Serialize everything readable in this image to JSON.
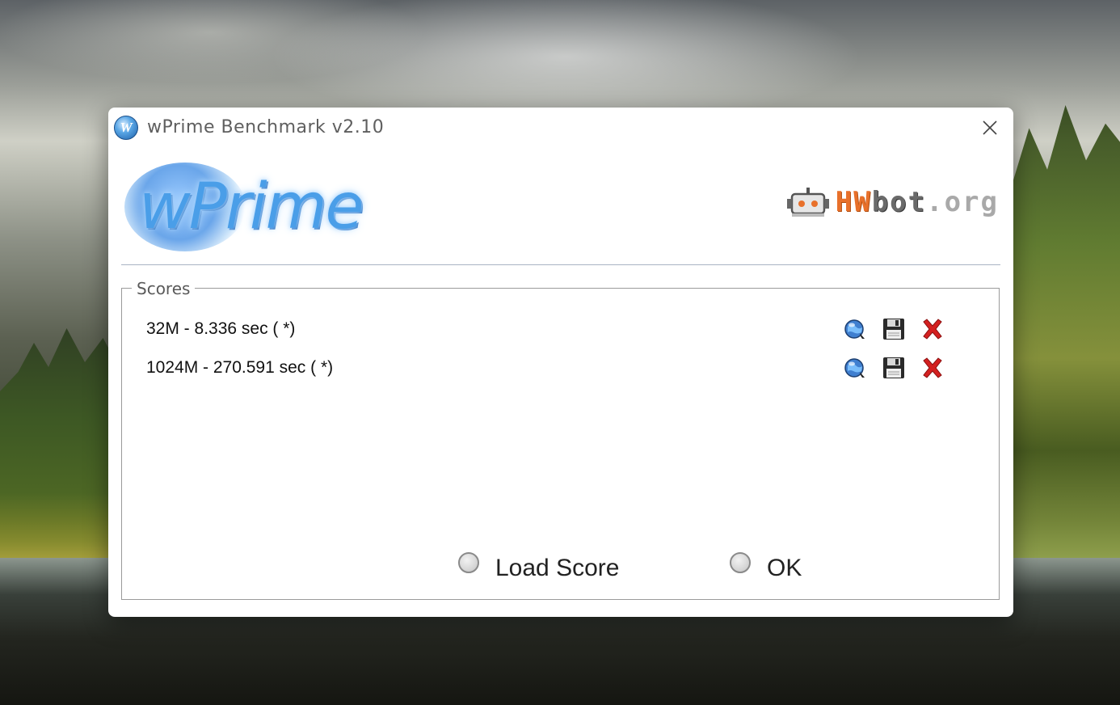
{
  "window": {
    "title": "wPrime Benchmark v2.10",
    "app_icon_letter": "W"
  },
  "logos": {
    "wprime": "wPrime",
    "hwbot_hw": "HW",
    "hwbot_bot": "bot",
    "hwbot_org": ".org"
  },
  "scores": {
    "legend": "Scores",
    "rows": [
      {
        "text": "32M - 8.336 sec (  *)"
      },
      {
        "text": "1024M - 270.591 sec (  *)"
      }
    ]
  },
  "actions": {
    "load_score": "Load Score",
    "ok": "OK"
  },
  "icons": {
    "row": [
      "globe-icon",
      "floppy-disk-icon",
      "red-x-delete-icon"
    ],
    "close": "close-icon"
  },
  "colors": {
    "hwbot_orange": "#e8702a",
    "wprime_blue": "#4a9ee8",
    "delete_red": "#d42020"
  }
}
